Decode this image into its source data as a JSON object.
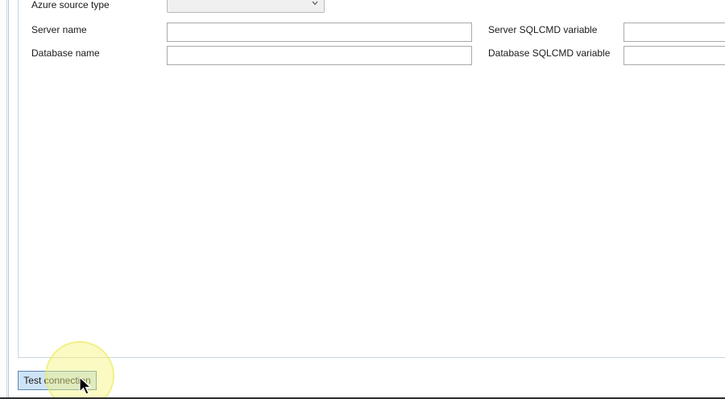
{
  "form": {
    "azure_source_type_label": "Azure source type",
    "azure_source_type_value": "",
    "server_name_label": "Server name",
    "server_name_value": "",
    "server_sqlcmd_label": "Server SQLCMD variable",
    "server_sqlcmd_value": "",
    "database_name_label": "Database name",
    "database_name_value": "",
    "database_sqlcmd_label": "Database SQLCMD variable",
    "database_sqlcmd_value": ""
  },
  "actions": {
    "test_connection_label": "Test connection"
  },
  "icons": {
    "dropdown": "chevron-down-icon",
    "pointer": "mouse-cursor-icon"
  },
  "colors": {
    "button_bg": "#cfe3f7",
    "button_border": "#5b86b4",
    "highlight": "#f5f578"
  }
}
